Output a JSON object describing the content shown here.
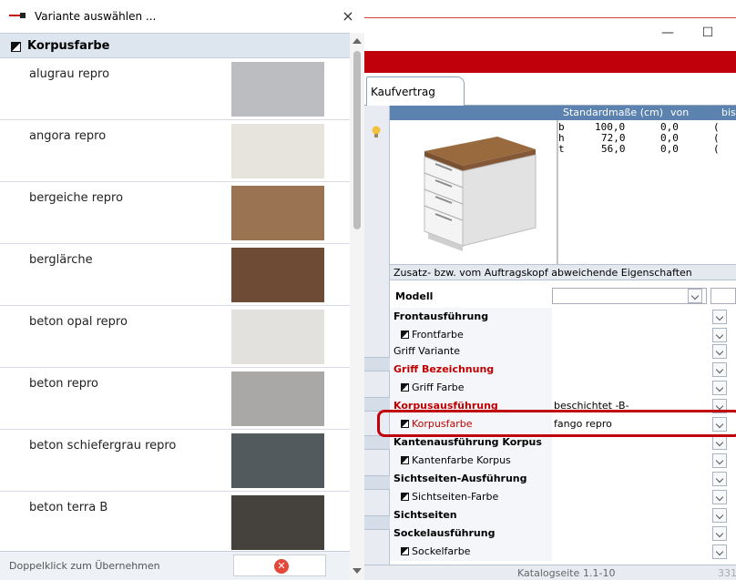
{
  "popup": {
    "title": "Variante auswählen ...",
    "close_glyph": "×",
    "section_title": "Korpusfarbe",
    "items": [
      {
        "name": "alugrau repro",
        "color": "#bcbdc0"
      },
      {
        "name": "angora repro",
        "color": "#e7e3dd"
      },
      {
        "name": "bergeiche repro",
        "color": "#9a7452"
      },
      {
        "name": "berglärche",
        "color": "#6e4b35"
      },
      {
        "name": "beton opal repro",
        "color": "#e3e1de"
      },
      {
        "name": "beton repro",
        "color": "#a9a8a6"
      },
      {
        "name": "beton schiefergrau repro",
        "color": "#535a5e"
      },
      {
        "name": "beton terra B",
        "color": "#45413d"
      }
    ],
    "footer_hint": "Doppelklick zum Übernehmen",
    "cancel_glyph": "✕"
  },
  "app": {
    "window_controls": {
      "minimize": "—",
      "maximize": "☐"
    },
    "tab_label": "Kaufvertrag",
    "dims_header": {
      "standard": "Standardmaße (cm)",
      "from": "von",
      "to": "bis"
    },
    "dims": [
      {
        "k": "b",
        "v": "100,0",
        "von": "0,0",
        "bis": "("
      },
      {
        "k": "h",
        "v": "72,0",
        "von": "0,0",
        "bis": "("
      },
      {
        "k": "t",
        "v": "56,0",
        "von": "0,0",
        "bis": "("
      }
    ],
    "sub_header": "Zusatz- bzw. vom Auftragskopf abweichende Eigenschaften",
    "model_label": "Modell",
    "properties": [
      {
        "label": "Frontausführung",
        "style": "bold",
        "value": ""
      },
      {
        "label": "Frontfarbe",
        "style": "sub",
        "value": ""
      },
      {
        "label": "Griff Variante",
        "style": "plain",
        "value": ""
      },
      {
        "label": "Griff Bezeichnung",
        "style": "bold-red",
        "value": ""
      },
      {
        "label": "Griff Farbe",
        "style": "sub",
        "value": ""
      },
      {
        "label": "Korpusausführung",
        "style": "bold-red",
        "value": "beschichtet -B-"
      },
      {
        "label": "Korpusfarbe",
        "style": "sub-red",
        "value": "fango repro"
      },
      {
        "label": "Kantenausführung Korpus",
        "style": "bold",
        "value": ""
      },
      {
        "label": "Kantenfarbe Korpus",
        "style": "sub",
        "value": ""
      },
      {
        "label": "Sichtseiten-Ausführung",
        "style": "bold",
        "value": ""
      },
      {
        "label": "Sichtseiten-Farbe",
        "style": "sub",
        "value": ""
      },
      {
        "label": "Sichtseiten",
        "style": "bold",
        "value": ""
      },
      {
        "label": "Sockelausführung",
        "style": "bold",
        "value": ""
      },
      {
        "label": "Sockelfarbe",
        "style": "sub",
        "value": ""
      }
    ],
    "status": {
      "catalog_label": "Katalogseite",
      "catalog_value": "1.1-10",
      "count": "331"
    }
  }
}
